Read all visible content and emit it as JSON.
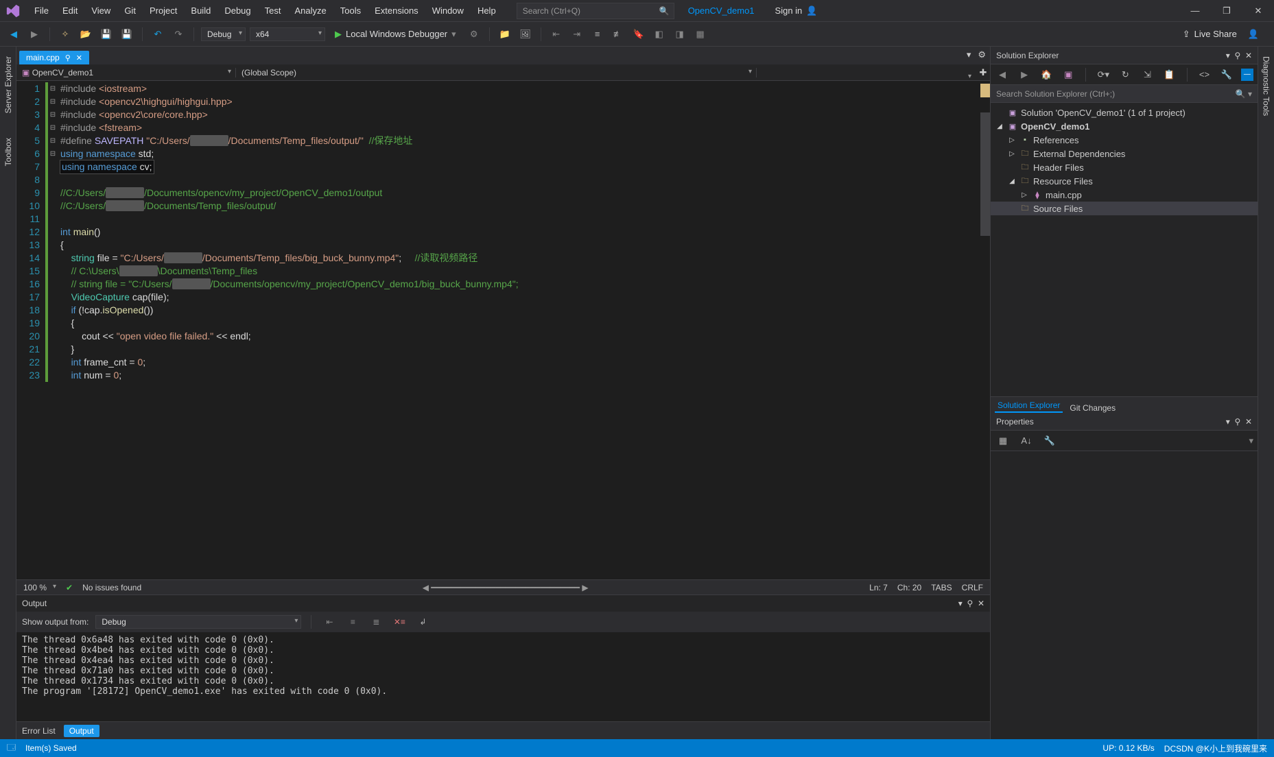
{
  "menu": [
    "File",
    "Edit",
    "View",
    "Git",
    "Project",
    "Build",
    "Debug",
    "Test",
    "Analyze",
    "Tools",
    "Extensions",
    "Window",
    "Help"
  ],
  "search_placeholder": "Search (Ctrl+Q)",
  "profile_name": "OpenCV_demo1",
  "signin": "Sign in",
  "toolbar": {
    "config": "Debug",
    "platform": "x64",
    "run": "Local Windows Debugger",
    "liveshare": "Live Share"
  },
  "tab_name": "main.cpp",
  "ctx_project": "OpenCV_demo1",
  "ctx_scope": "(Global Scope)",
  "code_lines": [
    {
      "n": 1,
      "fold": "⊟",
      "mod": 1,
      "html": "<span class='inc'>#include</span> <span class='str'>&lt;iostream&gt;</span>"
    },
    {
      "n": 2,
      "mod": 1,
      "html": "<span class='inc'>#include</span> <span class='str'>&lt;opencv2\\highgui/highgui.hpp&gt;</span>"
    },
    {
      "n": 3,
      "mod": 1,
      "html": "<span class='inc'>#include</span> <span class='str'>&lt;opencv2\\core/core.hpp&gt;</span>"
    },
    {
      "n": 4,
      "mod": 1,
      "html": "<span class='inc'>#include</span> <span class='str'>&lt;fstream&gt;</span>"
    },
    {
      "n": 5,
      "mod": 1,
      "html": "<span class='inc'>#define</span> <span class='def'>SAVEPATH</span> <span class='str'>\"C:/Users/<span class='smudge'>xxxxxxxx</span>/Documents/Temp_files/output/\"</span>  <span class='cm'>//保存地址</span>"
    },
    {
      "n": 6,
      "fold": "⊟",
      "mod": 1,
      "html": "<span class='kw'>using</span> <span class='kw'>namespace</span> std;"
    },
    {
      "n": 7,
      "mod": 1,
      "sel": 1,
      "html": "<span class='kw'>using</span> <span class='kw'>namespace</span> cv;"
    },
    {
      "n": 8,
      "mod": 1,
      "html": ""
    },
    {
      "n": 9,
      "fold": "⊟",
      "mod": 1,
      "html": "<span class='cm'>//C:/Users/<span class='smudge'>xxxxxxxx</span>/Documents/opencv/my_project/OpenCV_demo1/output</span>"
    },
    {
      "n": 10,
      "mod": 1,
      "html": "<span class='cm'>//C:/Users/<span class='smudge'>xxxxxxxx</span>/Documents/Temp_files/output/</span>"
    },
    {
      "n": 11,
      "mod": 1,
      "html": ""
    },
    {
      "n": 12,
      "fold": "⊟",
      "mod": 1,
      "html": "<span class='kw'>int</span> <span class='fn'>main</span>()"
    },
    {
      "n": 13,
      "mod": 1,
      "html": "{"
    },
    {
      "n": 14,
      "fold": "⊟",
      "mod": 1,
      "html": "    <span class='type'>string</span> file = <span class='str'>\"C:/Users/<span class='smudge'>xxxxxxxx</span>/Documents/Temp_files/big_buck_bunny.mp4\"</span>;     <span class='cm'>//读取视频路径</span>"
    },
    {
      "n": 15,
      "mod": 1,
      "html": "    <span class='cm'>// C:\\Users\\<span class='smudge'>xxxxxxxx</span>\\Documents\\Temp_files</span>"
    },
    {
      "n": 16,
      "mod": 1,
      "html": "    <span class='cm'>// string file = \"C:/Users/<span class='smudge'>xxxxxxxx</span>/Documents/opencv/my_project/OpenCV_demo1/big_buck_bunny.mp4\";</span>"
    },
    {
      "n": 17,
      "mod": 1,
      "html": "    <span class='type'>VideoCapture</span> cap(file);"
    },
    {
      "n": 18,
      "fold": "⊟",
      "mod": 1,
      "html": "    <span class='kw'>if</span> (!cap.<span class='fn'>isOpened</span>())"
    },
    {
      "n": 19,
      "mod": 1,
      "html": "    {"
    },
    {
      "n": 20,
      "mod": 1,
      "html": "        cout &lt;&lt; <span class='str'>\"open video file failed.\"</span> &lt;&lt; endl;"
    },
    {
      "n": 21,
      "mod": 1,
      "html": "    }"
    },
    {
      "n": 22,
      "mod": 1,
      "html": "    <span class='kw'>int</span> frame_cnt = <span class='str'>0</span>;"
    },
    {
      "n": 23,
      "mod": 1,
      "html": "    <span class='kw'>int</span> num = <span class='str'>0</span>;"
    }
  ],
  "ed_status": {
    "zoom": "100 %",
    "issues": "No issues found",
    "ln": "Ln: 7",
    "ch": "Ch: 20",
    "tabs": "TABS",
    "crlf": "CRLF"
  },
  "output": {
    "title": "Output",
    "from_label": "Show output from:",
    "from_value": "Debug",
    "lines": [
      "The thread 0x6a48 has exited with code 0 (0x0).",
      "The thread 0x4be4 has exited with code 0 (0x0).",
      "The thread 0x4ea4 has exited with code 0 (0x0).",
      "The thread 0x71a0 has exited with code 0 (0x0).",
      "The thread 0x1734 has exited with code 0 (0x0).",
      "The program '[28172] OpenCV_demo1.exe' has exited with code 0 (0x0)."
    ],
    "tabs": [
      "Error List",
      "Output"
    ]
  },
  "solution_explorer": {
    "title": "Solution Explorer",
    "search_placeholder": "Search Solution Explorer (Ctrl+;)",
    "solution": "Solution 'OpenCV_demo1' (1 of 1 project)",
    "project": "OpenCV_demo1",
    "nodes": [
      "References",
      "External Dependencies",
      "Header Files",
      "Resource Files"
    ],
    "resource_child": "main.cpp",
    "src": "Source Files",
    "tabs": [
      "Solution Explorer",
      "Git Changes"
    ]
  },
  "properties": {
    "title": "Properties"
  },
  "side_left": [
    "Server Explorer",
    "Toolbox"
  ],
  "side_right": "Diagnostic Tools",
  "statusbar": {
    "saved": "Item(s) Saved",
    "up": "UP: 0.12 KB/s",
    "csdn": "DCSDN @K小上到我碗里来"
  }
}
